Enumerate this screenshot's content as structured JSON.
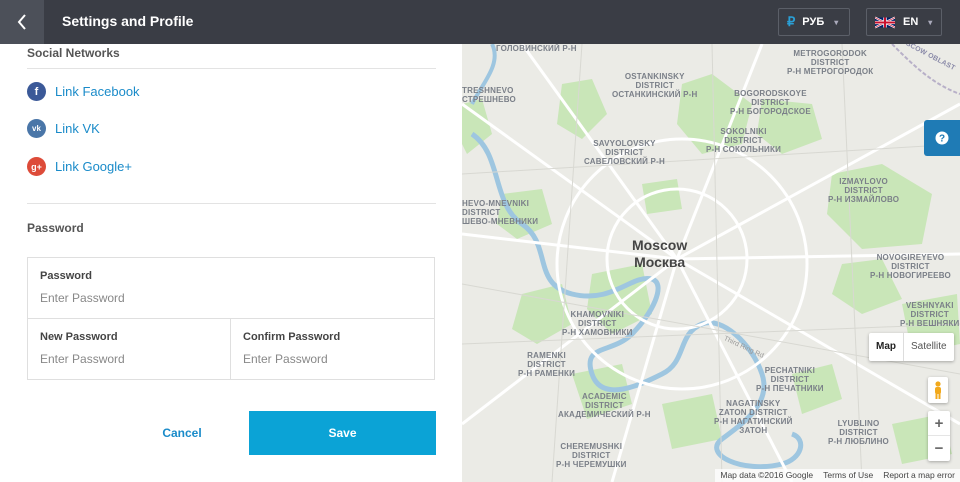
{
  "header": {
    "title": "Settings and Profile",
    "currency": "РУБ",
    "currency_symbol": "₽",
    "language": "EN"
  },
  "social": {
    "title": "Social Networks",
    "facebook": "Link Facebook",
    "vk": "Link VK",
    "google": "Link Google+"
  },
  "password": {
    "title": "Password",
    "current_label": "Password",
    "current_placeholder": "Enter Password",
    "new_label": "New Password",
    "new_placeholder": "Enter Password",
    "confirm_label": "Confirm Password",
    "confirm_placeholder": "Enter Password"
  },
  "actions": {
    "cancel": "Cancel",
    "save": "Save"
  },
  "map": {
    "city_en": "Moscow",
    "city_ru": "Москва",
    "districts": [
      {
        "en": "ГОЛОВИНСКИЙ Р-Н"
      },
      {
        "en": "OSTANKINSKY",
        "d": "DISTRICT",
        "ru": "ОСТАНКИНСКИЙ Р-Н"
      },
      {
        "en": "METROGORODOK",
        "d": "DISTRICT",
        "ru": "Р-Н МЕТРОГОРОДОК"
      },
      {
        "en": "TRESHNEVO",
        "d": "",
        "ru": "СТРЕШНЕВО"
      },
      {
        "en": "BOGORODSKOYE",
        "d": "DISTRICT",
        "ru": "Р-Н БОГОРОДСКОЕ"
      },
      {
        "en": "SAVYOLOVSKY",
        "d": "DISTRICT",
        "ru": "САВЕЛОВСКИЙ Р-Н"
      },
      {
        "en": "SOKOLNIKI",
        "d": "DISTRICT",
        "ru": "Р-Н СОКОЛЬНИКИ"
      },
      {
        "en": "HEVO-MNEVNIKI",
        "d": "DISTRICT",
        "ru": "ШЕВО-МНЕВНИКИ"
      },
      {
        "en": "IZMAYLOVO",
        "d": "DISTRICT",
        "ru": "Р-Н ИЗМАЙЛОВО"
      },
      {
        "en": "NOVOGIREYEVO",
        "d": "DISTRICT",
        "ru": "Р-Н НОВОГИРЕЕВО"
      },
      {
        "en": "KHAMOVNIKI",
        "d": "DISTRICT",
        "ru": "Р-Н ХАМОВНИКИ"
      },
      {
        "en": "VESHNYAKI",
        "d": "DISTRICT",
        "ru": "Р-Н ВЕШНЯКИ"
      },
      {
        "en": "RAMENKI",
        "d": "DISTRICT",
        "ru": "Р-Н РАМЕНКИ"
      },
      {
        "en": "PECHATNIKI",
        "d": "DISTRICT",
        "ru": "Р-Н ПЕЧАТНИКИ"
      },
      {
        "en": "ACADEMIC",
        "d": "DISTRICT",
        "ru": "АКАДЕМИЧЕСКИЙ Р-Н"
      },
      {
        "en": "NAGATINSKY",
        "d": "ZATON DISTRICT",
        "ru": "Р-Н НАГАТИНСКИЙ",
        "ru2": "ЗАТОН"
      },
      {
        "en": "LYUBLINO",
        "d": "DISTRICT",
        "ru": "Р-Н ЛЮБЛИНО"
      },
      {
        "en": "CHEREMUSHKI",
        "d": "DISTRICT",
        "ru": "Р-Н ЧЕРЕМУШКИ"
      }
    ],
    "road": "Third Ring Rd",
    "oblast": "MOSCOW OBLAST",
    "map_button": "Map",
    "satellite_button": "Satellite",
    "zoom_in": "+",
    "zoom_out": "−",
    "attribution": "Map data ©2016 Google",
    "terms": "Terms of Use",
    "report": "Report a map error"
  }
}
